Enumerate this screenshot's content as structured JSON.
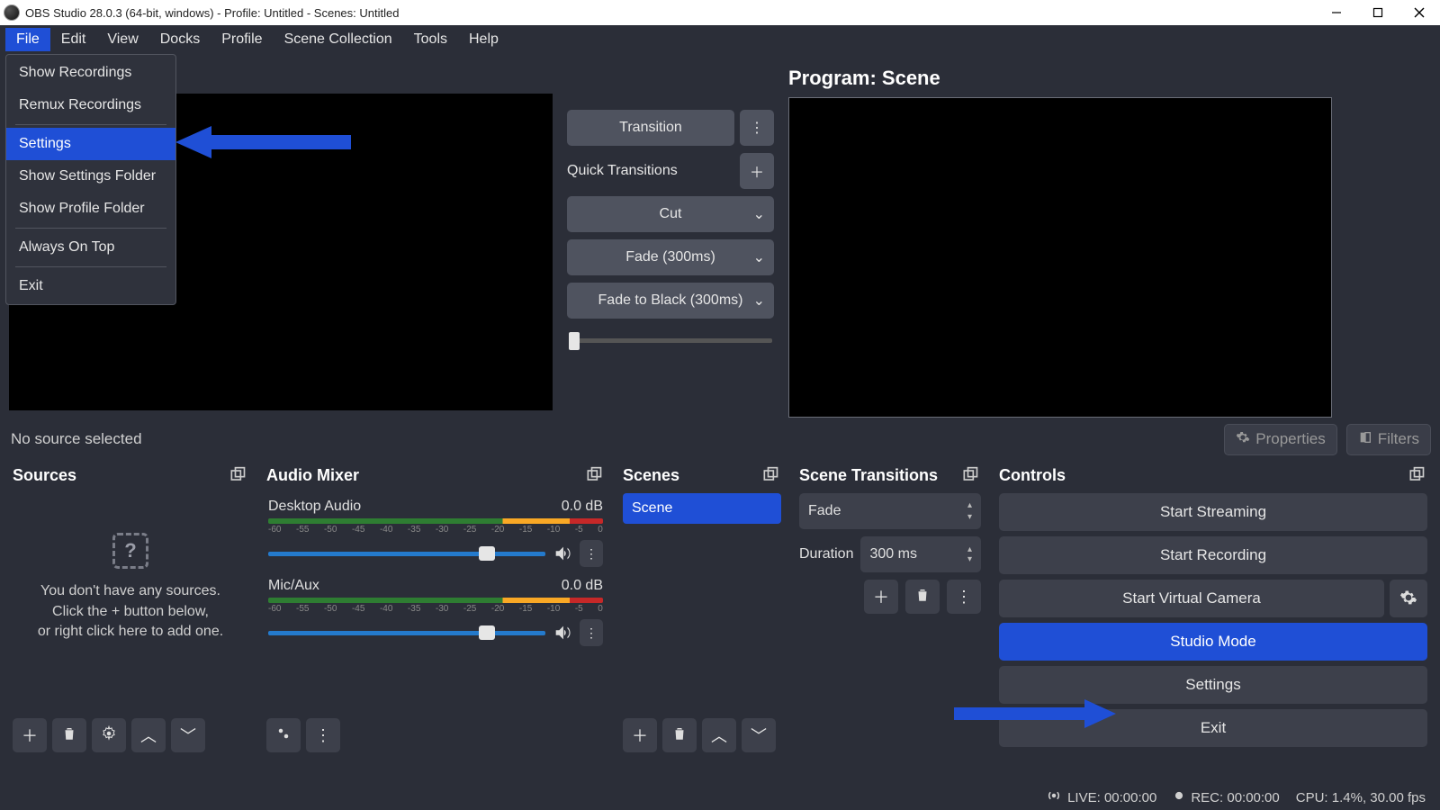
{
  "window": {
    "title": "OBS Studio 28.0.3 (64-bit, windows) - Profile: Untitled - Scenes: Untitled"
  },
  "menubar": {
    "items": [
      "File",
      "Edit",
      "View",
      "Docks",
      "Profile",
      "Scene Collection",
      "Tools",
      "Help"
    ]
  },
  "file_menu": {
    "items": [
      "Show Recordings",
      "Remux Recordings",
      "Settings",
      "Show Settings Folder",
      "Show Profile Folder",
      "Always On Top",
      "Exit"
    ]
  },
  "program_title": "Program: Scene",
  "transition": {
    "button": "Transition",
    "quick_label": "Quick Transitions",
    "options": [
      "Cut",
      "Fade (300ms)",
      "Fade to Black (300ms)"
    ]
  },
  "nosrc": {
    "label": "No source selected",
    "properties": "Properties",
    "filters": "Filters"
  },
  "panels": {
    "sources": "Sources",
    "mixer": "Audio Mixer",
    "scenes": "Scenes",
    "trans": "Scene Transitions",
    "controls": "Controls"
  },
  "sources_empty": {
    "l1": "You don't have any sources.",
    "l2": "Click the + button below,",
    "l3": "or right click here to add one."
  },
  "mixer": {
    "ch1": {
      "name": "Desktop Audio",
      "level": "0.0 dB"
    },
    "ch2": {
      "name": "Mic/Aux",
      "level": "0.0 dB"
    },
    "ticks": [
      "-60",
      "-55",
      "-50",
      "-45",
      "-40",
      "-35",
      "-30",
      "-25",
      "-20",
      "-15",
      "-10",
      "-5",
      "0"
    ]
  },
  "scenes": {
    "row": "Scene"
  },
  "scene_trans": {
    "select": "Fade",
    "duration_label": "Duration",
    "duration_value": "300 ms"
  },
  "controls": {
    "streaming": "Start Streaming",
    "recording": "Start Recording",
    "virtual": "Start Virtual Camera",
    "studio": "Studio Mode",
    "settings": "Settings",
    "exit": "Exit"
  },
  "status": {
    "live": "LIVE: 00:00:00",
    "rec": "REC: 00:00:00",
    "cpu": "CPU: 1.4%, 30.00 fps"
  }
}
